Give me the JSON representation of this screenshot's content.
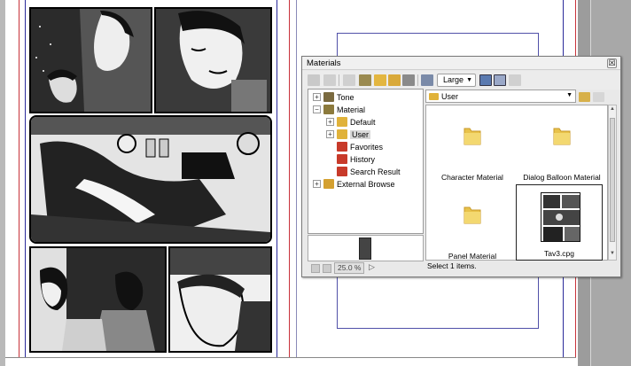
{
  "palette": {
    "title": "Materials",
    "close_glyph": "☒",
    "size_select": "Large",
    "tree": [
      {
        "label": "Tone",
        "indent": 0,
        "expander": "+",
        "icon": "tone-folder-icon",
        "color": "#7a6a40"
      },
      {
        "label": "Material",
        "indent": 0,
        "expander": "−",
        "icon": "material-folder-icon",
        "color": "#8c7a3c"
      },
      {
        "label": "Default",
        "indent": 1,
        "expander": "+",
        "icon": "folder-icon",
        "color": "#e0b23a"
      },
      {
        "label": "User",
        "indent": 1,
        "expander": "+",
        "icon": "folder-icon",
        "color": "#e0b23a",
        "selected": true
      },
      {
        "label": "Favorites",
        "indent": 1,
        "expander": "",
        "icon": "favorites-icon",
        "color": "#c83a2a"
      },
      {
        "label": "History",
        "indent": 1,
        "expander": "",
        "icon": "history-icon",
        "color": "#c83a2a"
      },
      {
        "label": "Search Result",
        "indent": 1,
        "expander": "",
        "icon": "search-result-icon",
        "color": "#c83a2a"
      },
      {
        "label": "External Browse",
        "indent": 0,
        "expander": "+",
        "icon": "external-browse-icon",
        "color": "#d4a030"
      }
    ],
    "zoom": "25.0 %",
    "zoom_arrow": "▷",
    "folder_path": "User",
    "items": [
      {
        "label": "Character Material",
        "type": "folder"
      },
      {
        "label": "Dialog Balloon Material",
        "type": "folder"
      },
      {
        "label": "Panel Material",
        "type": "folder"
      },
      {
        "label": "Tav3.cpg",
        "type": "file",
        "selected": true
      }
    ],
    "status": "Select 1 items.",
    "colors": {
      "folder": "#e8c24a",
      "accent_red": "#c8323a",
      "accent_blue": "#2a2a9a"
    }
  }
}
